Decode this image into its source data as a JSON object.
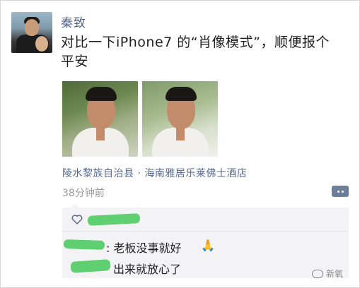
{
  "post": {
    "author_name": "秦致",
    "content": "对比一下iPhone7 的“肖像模式”，顺便报个平安",
    "location": "陵水黎族自治县 · 海南雅居乐莱佛士酒店",
    "time": "38分钟前"
  },
  "comments": [
    {
      "text": ": 老板没事就好",
      "emoji": "🙏"
    },
    {
      "text": "出来就放心了"
    }
  ],
  "watermark": {
    "text": "新氧"
  },
  "colors": {
    "name_blue": "#56688f",
    "time_gray": "#9b9b9b",
    "redaction_green": "#57cc6a",
    "panel_bg": "#f3f3f5"
  },
  "icons": {
    "like": "heart-outline-icon",
    "more": "comment-more-icon"
  }
}
